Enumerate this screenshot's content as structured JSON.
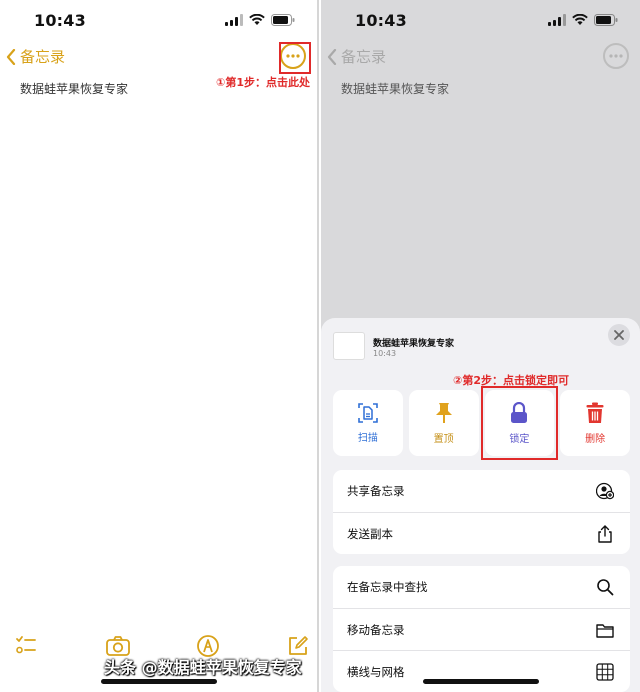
{
  "left": {
    "status_time": "10:43",
    "back_label": "备忘录",
    "note_text": "数据蛙苹果恢复专家",
    "annotation": "①第1步：点击此处",
    "toolbar_icons": [
      "checklist-icon",
      "camera-icon",
      "markup-pen-icon",
      "compose-icon"
    ]
  },
  "right": {
    "status_time": "10:43",
    "back_label": "备忘录",
    "note_text": "数据蛙苹果恢复专家",
    "sheet": {
      "title": "数据蛙苹果恢复专家",
      "time": "10:43",
      "annotation": "②第2步：点击锁定即可",
      "actions": [
        {
          "label": "扫描",
          "icon": "scan-doc-icon",
          "color": "#2f6fd6"
        },
        {
          "label": "置顶",
          "icon": "pin-icon",
          "color": "#e0a21d"
        },
        {
          "label": "锁定",
          "icon": "lock-icon",
          "color": "#5b55c9"
        },
        {
          "label": "删除",
          "icon": "trash-icon",
          "color": "#e2362f"
        }
      ],
      "group1": [
        {
          "label": "共享备忘录",
          "icon": "share-person-icon"
        },
        {
          "label": "发送副本",
          "icon": "share-icon"
        }
      ],
      "group2": [
        {
          "label": "在备忘录中查找",
          "icon": "search-icon"
        },
        {
          "label": "移动备忘录",
          "icon": "folder-icon"
        },
        {
          "label": "横线与网格",
          "icon": "grid-icon"
        }
      ]
    },
    "watermark": "头条 @数据蛙苹果恢复专家"
  },
  "colors": {
    "accent": "#d8a21a",
    "annotation": "#e02a2a"
  }
}
